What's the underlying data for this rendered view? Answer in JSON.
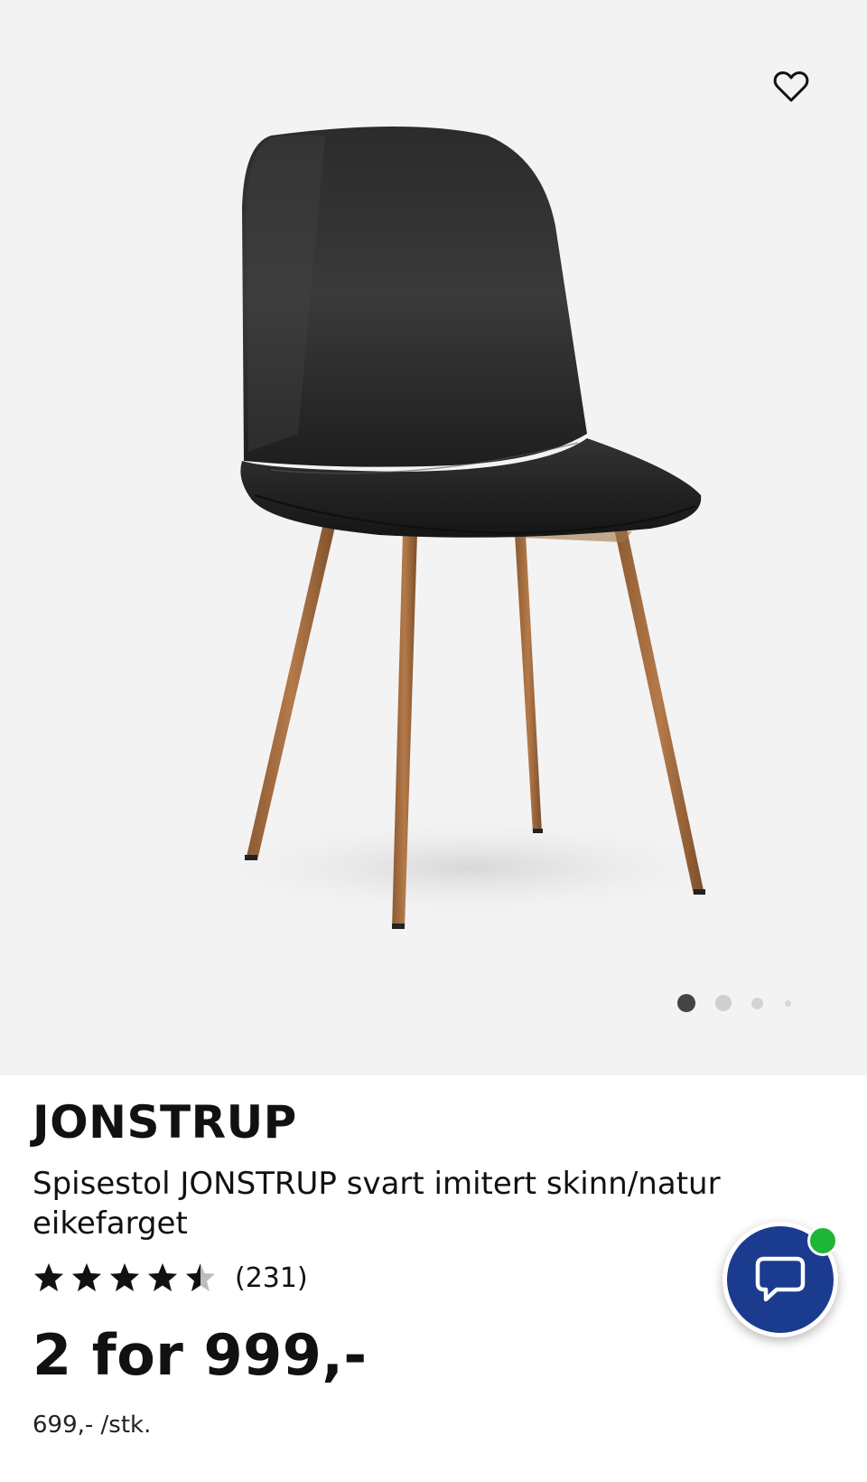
{
  "product": {
    "name": "JONSTRUP",
    "description": "Spisestol JONSTRUP svart imitert skinn/natur eikefarget",
    "review_count": "(231)",
    "rating": 4.5,
    "rating_max": 5,
    "price": "2 for 999,-",
    "unit_price": "699,- /stk."
  },
  "gallery": {
    "image_count": 4,
    "active_index": 0
  },
  "icons": {
    "favorite": "heart-outline-icon",
    "chat": "chat-bubble-icon",
    "star": "star-icon"
  },
  "colors": {
    "gallery_background": "#f4f3f3",
    "chat_button": "#1b3b8f",
    "online_indicator": "#1fb537",
    "text": "#111111"
  }
}
